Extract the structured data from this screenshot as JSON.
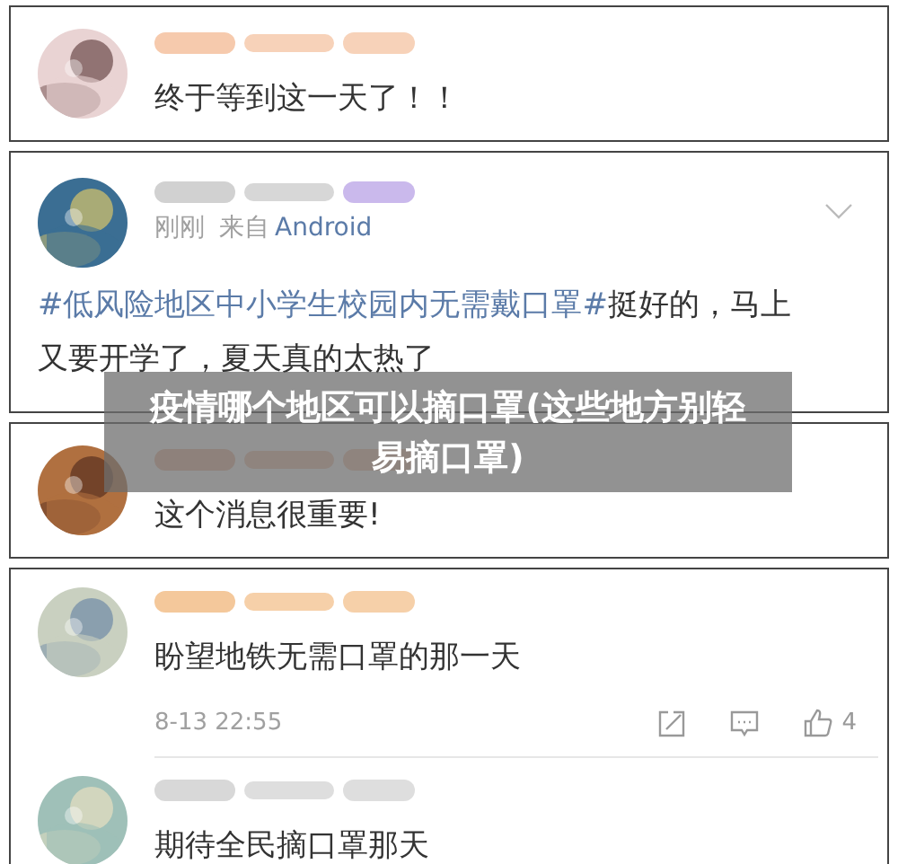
{
  "cards": [
    {
      "kind": "plain",
      "comments": [
        {
          "text": "终于等到这一天了！！"
        }
      ]
    },
    {
      "kind": "post",
      "comments": [
        {
          "time": "刚刚",
          "source_prefix": "来自",
          "source": "Android",
          "hashtag": "#低风险地区中小学生校园内无需戴口罩#",
          "text": "挺好的，马上又要开学了，夏天真的太热了"
        }
      ]
    },
    {
      "kind": "plain",
      "comments": [
        {
          "text": "这个消息很重要!"
        }
      ]
    },
    {
      "kind": "thread",
      "comments": [
        {
          "text": "盼望地铁无需口罩的那一天",
          "time": "8-13 22:55",
          "likes": "4"
        },
        {
          "text": "期待全民摘口罩那天"
        }
      ]
    }
  ],
  "banner": {
    "title": "疫情哪个地区可以摘口罩(这些地方别轻易摘口罩)"
  }
}
